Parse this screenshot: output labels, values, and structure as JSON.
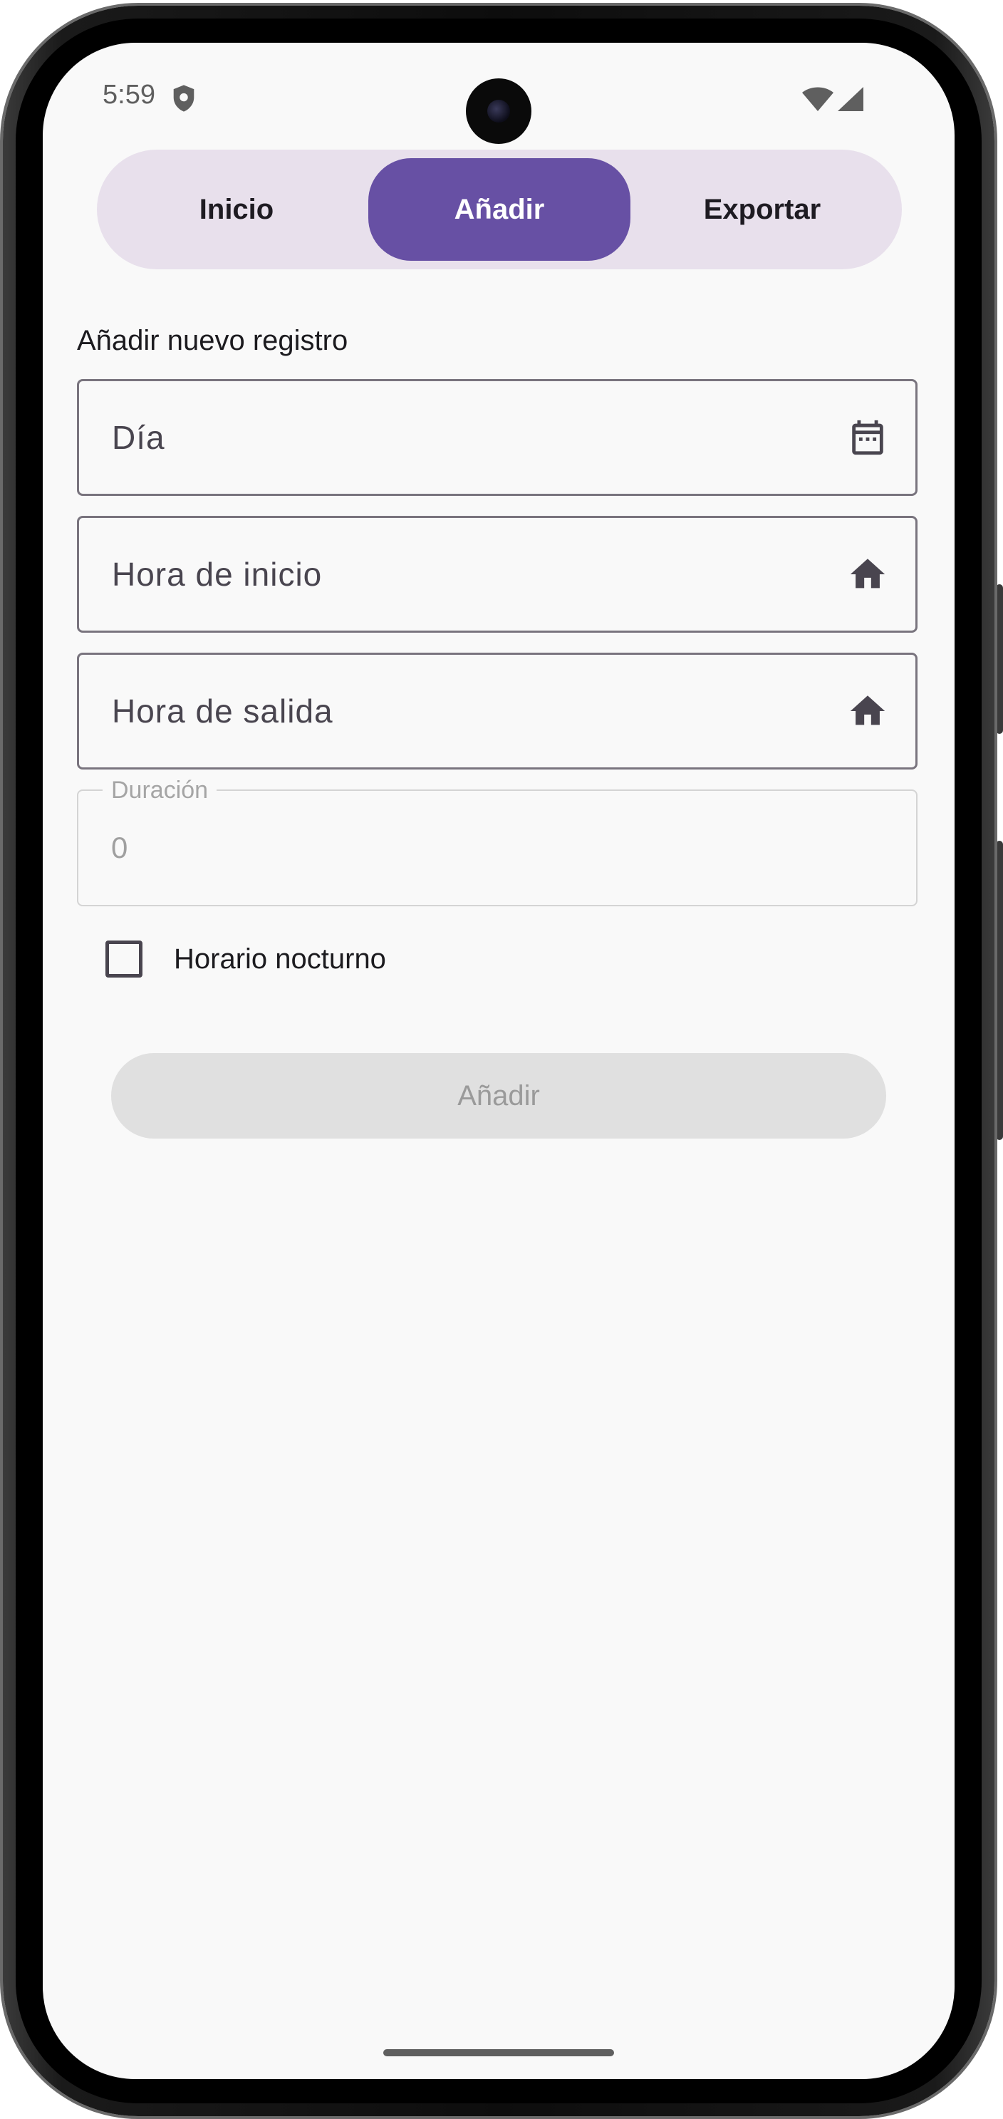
{
  "status_bar": {
    "time": "5:59",
    "icons": [
      "shield-icon",
      "wifi-icon",
      "cellular-signal-icon"
    ]
  },
  "tabs": [
    {
      "label": "Inicio",
      "selected": false
    },
    {
      "label": "Añadir",
      "selected": true
    },
    {
      "label": "Exportar",
      "selected": false
    }
  ],
  "form": {
    "title": "Añadir nuevo registro",
    "day_field": {
      "placeholder": "Día",
      "icon": "calendar-icon"
    },
    "start_field": {
      "placeholder": "Hora de inicio",
      "icon": "home-icon"
    },
    "end_field": {
      "placeholder": "Hora de salida",
      "icon": "home-icon"
    },
    "duration_field": {
      "label": "Duración",
      "value": "0",
      "disabled": true
    },
    "night_checkbox": {
      "label": "Horario nocturno",
      "checked": false
    },
    "submit_label": "Añadir"
  },
  "colors": {
    "accent": "#6750a4",
    "tab_track": "#e8e0ec",
    "background": "#f9f9f9",
    "disabled_button": "#e0e0e0"
  }
}
